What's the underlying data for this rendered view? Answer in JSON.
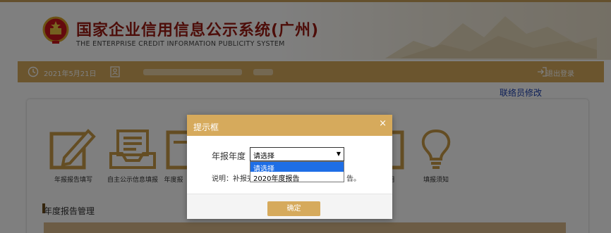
{
  "header": {
    "title": "国家企业信用信息公示系统(广州)",
    "subtitle": "THE ENTERPRISE CREDIT INFORMATION PUBLICITY SYSTEM"
  },
  "infobar": {
    "date": "2021年5月21日",
    "logout_label": "退出登录"
  },
  "link": {
    "contact_edit": "联络员修改"
  },
  "tiles": [
    {
      "label": "年报报告填写",
      "icon": "pen-paper-icon"
    },
    {
      "label": "自主公示信息填报",
      "icon": "inbox-tray-icon"
    },
    {
      "label": "年度报",
      "icon": "document-stack-icon"
    },
    {
      "label": "明",
      "icon": "document-icon"
    },
    {
      "label": "填报须知",
      "icon": "lightbulb-icon"
    }
  ],
  "section": {
    "title": "年度报告管理"
  },
  "dialog": {
    "title": "提示框",
    "close_symbol": "×",
    "year_label": "年报年度",
    "select_value": "请选择",
    "options": [
      "请选择",
      "2020年度报告"
    ],
    "note_prefix": "说明：补报完",
    "note_suffix": "告。",
    "confirm_label": "确定"
  },
  "colors": {
    "accent": "#d6aa5c",
    "title_red": "#9b1a12",
    "link_blue": "#1a3fb0",
    "option_highlight": "#1e6ee6"
  }
}
